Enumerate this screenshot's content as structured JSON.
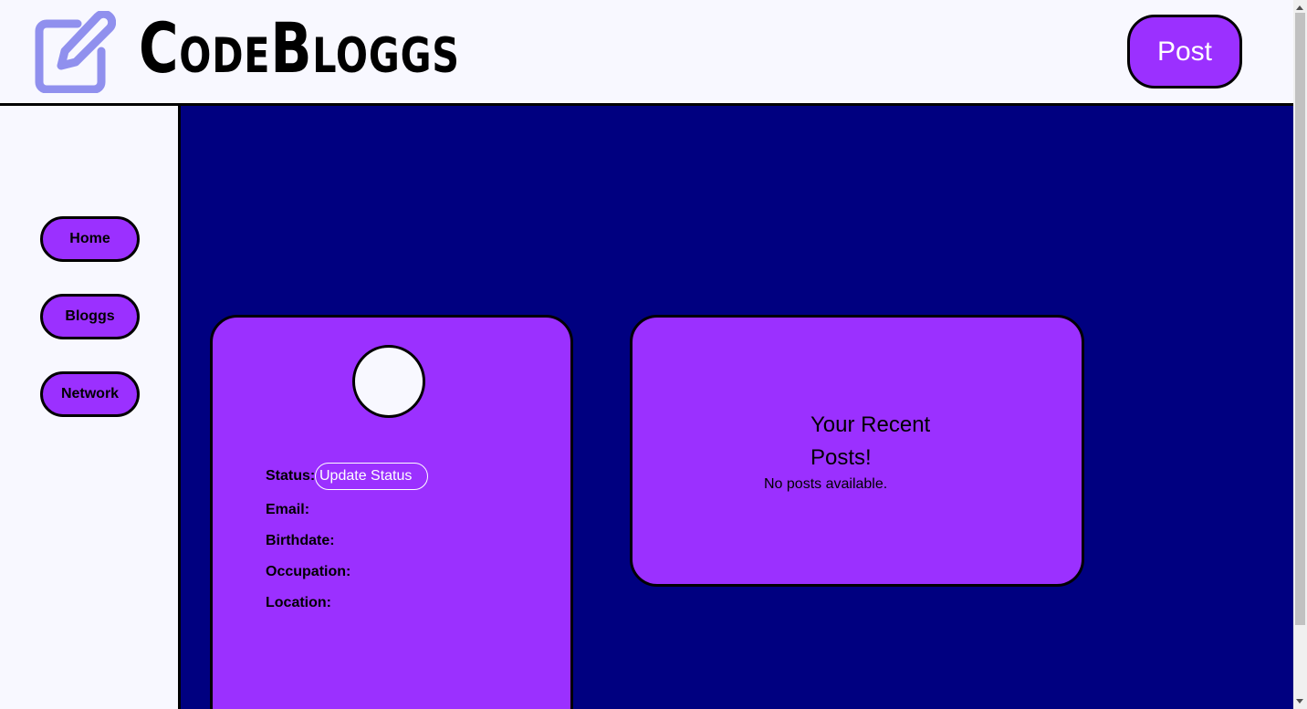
{
  "header": {
    "logo_icon": "edit-square-icon",
    "logo_text": "CodeBloggs",
    "post_button": "Post"
  },
  "sidebar": {
    "items": [
      {
        "label": "Home"
      },
      {
        "label": "Bloggs"
      },
      {
        "label": "Network"
      }
    ]
  },
  "profile": {
    "status_label": "Status:",
    "status_placeholder": "Update Status",
    "email_label": "Email:",
    "birthdate_label": "Birthdate:",
    "occupation_label": "Occupation:",
    "location_label": "Location:"
  },
  "recent_posts": {
    "title": "Your Recent Posts!",
    "empty_message": "No posts available."
  },
  "colors": {
    "accent": "#9b30ff",
    "main_bg": "#000080",
    "page_bg": "#f8f8ff",
    "logo_icon": "#9090ee"
  }
}
